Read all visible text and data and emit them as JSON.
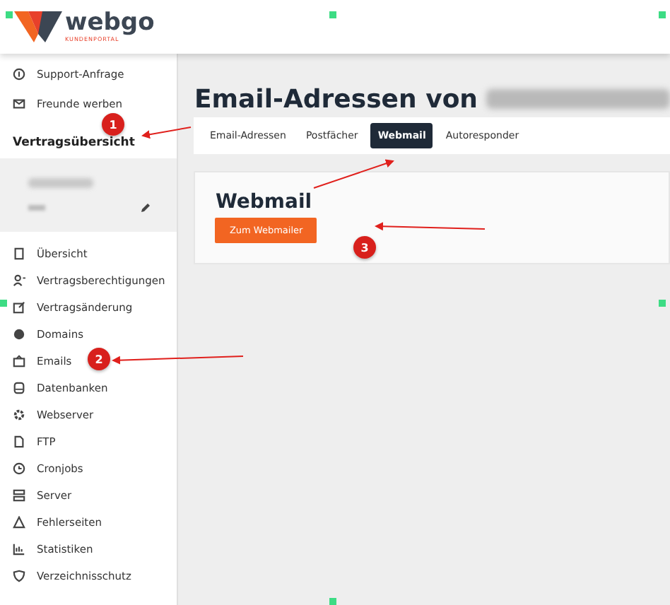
{
  "header": {
    "logo_text": "webgo",
    "logo_subtitle": "KUNDENPORTAL"
  },
  "sidebar": {
    "top_items": [
      {
        "label": "Support-Anfrage"
      },
      {
        "label": "Freunde werben"
      }
    ],
    "section_title": "Vertragsübersicht",
    "items": [
      {
        "label": "Übersicht"
      },
      {
        "label": "Vertragsberechtigungen"
      },
      {
        "label": "Vertragsänderung"
      },
      {
        "label": "Domains"
      },
      {
        "label": "Emails"
      },
      {
        "label": "Datenbanken"
      },
      {
        "label": "Webserver"
      },
      {
        "label": "FTP"
      },
      {
        "label": "Cronjobs"
      },
      {
        "label": "Server"
      },
      {
        "label": "Fehlerseiten"
      },
      {
        "label": "Statistiken"
      },
      {
        "label": "Verzeichnisschutz"
      }
    ]
  },
  "main": {
    "heading": "Email-Adressen von",
    "tabs": [
      {
        "label": "Email-Adressen",
        "selected": false
      },
      {
        "label": "Postfächer",
        "selected": false
      },
      {
        "label": "Webmail",
        "selected": true
      },
      {
        "label": "Autoresponder",
        "selected": false
      }
    ],
    "card": {
      "title": "Webmail",
      "button": "Zum Webmailer"
    }
  },
  "annotations": [
    {
      "label": "1"
    },
    {
      "label": "2"
    },
    {
      "label": "3"
    }
  ]
}
